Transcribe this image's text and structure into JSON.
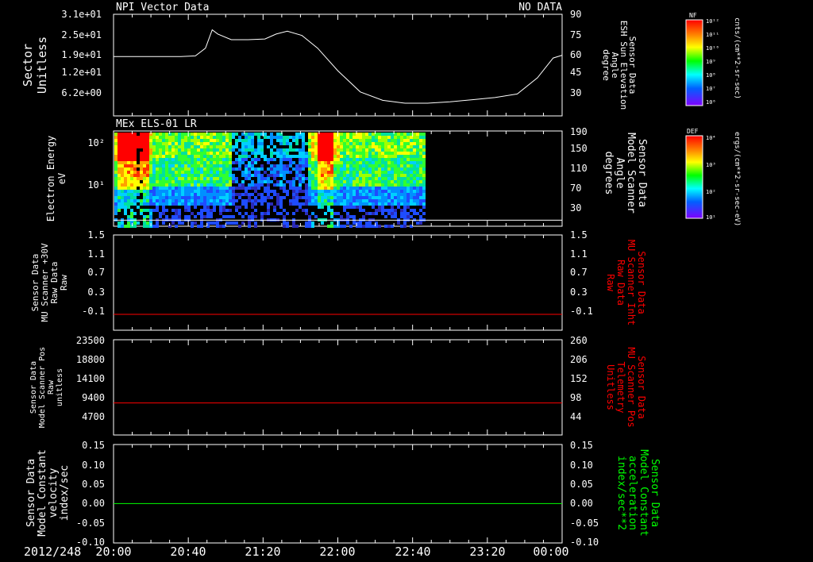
{
  "colors": {
    "background": "#000000",
    "frame": "#ffffff",
    "red": "#ff0000",
    "green": "#00ff00"
  },
  "footer": {
    "date_label": "2012/248"
  },
  "x_axis": {
    "range": [
      "20:00",
      "00:00"
    ],
    "tick_labels": [
      "20:00",
      "20:40",
      "21:20",
      "22:00",
      "22:40",
      "23:20",
      "00:00"
    ]
  },
  "colorbars": [
    {
      "title": "NF",
      "ticks": [
        "10¹²",
        "10¹¹",
        "10¹⁰",
        "10⁹",
        "10⁸",
        "10⁷",
        "10⁶"
      ],
      "unit": "cnts/(cm**2-sr-sec)"
    },
    {
      "title": "DEF",
      "ticks": [
        "10⁴",
        "10³",
        "10²",
        "10¹"
      ],
      "unit": "ergs/(cm**2-sr-sec-eV)"
    }
  ],
  "chart_data": [
    {
      "type": "line",
      "title": "NPI Vector Data",
      "status": "NO DATA",
      "left_axis": {
        "label_lines": [
          "Sector",
          "Unitless"
        ],
        "ticks": [
          "3.1e+01",
          "2.5e+01",
          "1.9e+01",
          "1.2e+01",
          "6.2e+00"
        ]
      },
      "right_axis": {
        "label_lines": [
          "Sensor Data",
          "ESH Sun Elevation",
          "Angle",
          "degree"
        ],
        "ticks": [
          "90",
          "75",
          "60",
          "45",
          "30"
        ],
        "ylim": [
          18,
          90
        ]
      },
      "series": [
        {
          "color": "#ffffff",
          "x_hours": [
            0,
            0.3,
            0.6,
            0.73,
            0.82,
            0.88,
            0.93,
            1.05,
            1.2,
            1.35,
            1.45,
            1.55,
            1.68,
            1.82,
            2.0,
            2.2,
            2.4,
            2.6,
            2.8,
            3.0,
            3.2,
            3.4,
            3.6,
            3.78,
            3.92,
            4.0
          ],
          "values": [
            60,
            60,
            60,
            60.5,
            66,
            79,
            76,
            72,
            72,
            72.5,
            76,
            78,
            75,
            66,
            50,
            35,
            29,
            27,
            27,
            28,
            29.5,
            31,
            33.5,
            45,
            59,
            61
          ]
        }
      ]
    },
    {
      "type": "heatmap",
      "title": "MEx ELS-01 LR",
      "left_axis": {
        "label_lines": [
          "Electron Energy",
          "eV"
        ],
        "ticks": [
          "10²",
          "10¹"
        ]
      },
      "right_axis": {
        "label_lines": [
          "Sensor Data",
          "Model Scanner",
          "Angle",
          "degrees"
        ],
        "ticks": [
          "190",
          "150",
          "110",
          "70",
          "30"
        ],
        "ylim": [
          0,
          190
        ]
      },
      "data_end": "22:46",
      "hot_intervals": [
        [
          "20:01",
          "20:18"
        ],
        [
          "21:49",
          "21:57"
        ]
      ],
      "series": [
        {
          "color": "#ffffff",
          "constant": 12
        }
      ]
    },
    {
      "type": "line",
      "left_axis": {
        "label_lines": [
          "Sensor Data",
          "MU Scanner +30V",
          "Raw Data",
          "Raw"
        ],
        "ticks": [
          "1.5",
          "1.1",
          "0.7",
          "0.3",
          "-0.1"
        ],
        "ylim": [
          -0.3,
          1.5
        ]
      },
      "right_axis": {
        "label_lines": [
          "Sensor Data",
          "MU Scanner Inht",
          "Raw Data",
          "Raw"
        ],
        "ticks": [
          "1.5",
          "1.1",
          "0.7",
          "0.3",
          "-0.1"
        ],
        "ylim": [
          -0.3,
          1.5
        ]
      },
      "series": [
        {
          "color": "#ff0000",
          "constant": 0.0
        }
      ]
    },
    {
      "type": "line",
      "left_axis": {
        "label_lines": [
          "Sensor Data",
          "Model Scanner Pos",
          "Raw",
          "unitless"
        ],
        "ticks": [
          "23500",
          "18800",
          "14100",
          "9400",
          "4700"
        ],
        "ylim": [
          0,
          23500
        ]
      },
      "right_axis": {
        "label_lines": [
          "Sensor Data",
          "MU Scanner Pos",
          "Telemetry",
          "Unitless"
        ],
        "ticks": [
          "260",
          "206",
          "152",
          "98",
          "44"
        ],
        "ylim": [
          0,
          260
        ]
      },
      "series": [
        {
          "color": "#ff0000",
          "constant": 7900
        }
      ]
    },
    {
      "type": "line",
      "left_axis": {
        "label_lines": [
          "Sensor Data",
          "Model Constant",
          "velocity",
          "index/sec"
        ],
        "ticks": [
          "0.15",
          "0.10",
          "0.05",
          "0.00",
          "-0.05",
          "-0.10"
        ],
        "ylim": [
          -0.1,
          0.15
        ]
      },
      "right_axis": {
        "label_lines": [
          "Sensor Data",
          "Model Constant",
          "acceleration",
          "index/sec**2"
        ],
        "ticks": [
          "0.15",
          "0.10",
          "0.05",
          "0.00",
          "-0.05",
          "-0.10"
        ],
        "ylim": [
          -0.1,
          0.15
        ]
      },
      "series": [
        {
          "color": "#00ff00",
          "constant": 0.0
        }
      ]
    }
  ]
}
